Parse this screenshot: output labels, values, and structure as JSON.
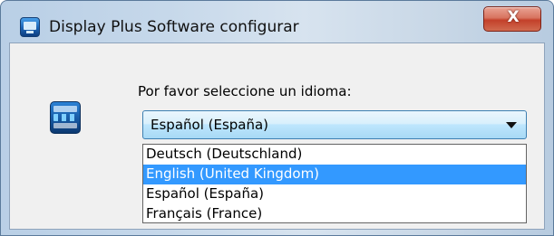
{
  "window": {
    "title": "Display Plus Software configurar",
    "close_glyph": "X",
    "icons": {
      "title_icon": "display-plus-icon",
      "close_icon": "close-icon",
      "app_icon": "display-plus-app-icon"
    }
  },
  "dialog": {
    "prompt": "Por favor seleccione un idioma:",
    "language_select": {
      "selected_value": "Español (España)",
      "options": [
        "Deutsch (Deutschland)",
        "English (United Kingdom)",
        "Español (España)",
        "Français (France)"
      ],
      "highlighted_option": "English (United Kingdom)"
    }
  },
  "colors": {
    "highlight": "#3399ff",
    "close_button": "#c3402a"
  }
}
